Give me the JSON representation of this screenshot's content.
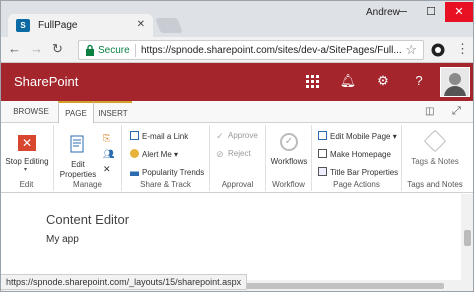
{
  "browser": {
    "tab_title": "FullPage",
    "user": "Andrew",
    "secure_label": "Secure",
    "url": "https://spnode.sharepoint.com/sites/dev-a/SitePages/Full...",
    "status_url": "https://spnode.sharepoint.com/_layouts/15/sharepoint.aspx"
  },
  "suitebar": {
    "brand": "SharePoint",
    "color": "#a4262c",
    "icons": [
      "app-launcher-icon",
      "bell-icon",
      "gear-icon",
      "help-icon"
    ]
  },
  "ribbon_tabs": [
    "BROWSE",
    "PAGE",
    "INSERT"
  ],
  "ribbon": {
    "edit": {
      "stop_editing": "Stop Editing",
      "label": "Edit"
    },
    "manage": {
      "edit_properties": "Edit Properties",
      "label": "Manage"
    },
    "share_track": {
      "email_link": "E-mail a Link",
      "alert_me": "Alert Me",
      "popularity": "Popularity Trends",
      "label": "Share & Track"
    },
    "approval": {
      "approve": "Approve",
      "reject": "Reject",
      "label": "Approval"
    },
    "workflow": {
      "workflows": "Workflows",
      "label": "Workflow"
    },
    "page_actions": {
      "edit_mobile": "Edit Mobile Page",
      "make_homepage": "Make Homepage",
      "title_bar": "Title Bar Properties",
      "label": "Page Actions"
    },
    "tags": {
      "tags_notes": "Tags & Notes",
      "label": "Tags and Notes"
    }
  },
  "content": {
    "webpart_title": "Content Editor",
    "webpart_body": "My app"
  }
}
